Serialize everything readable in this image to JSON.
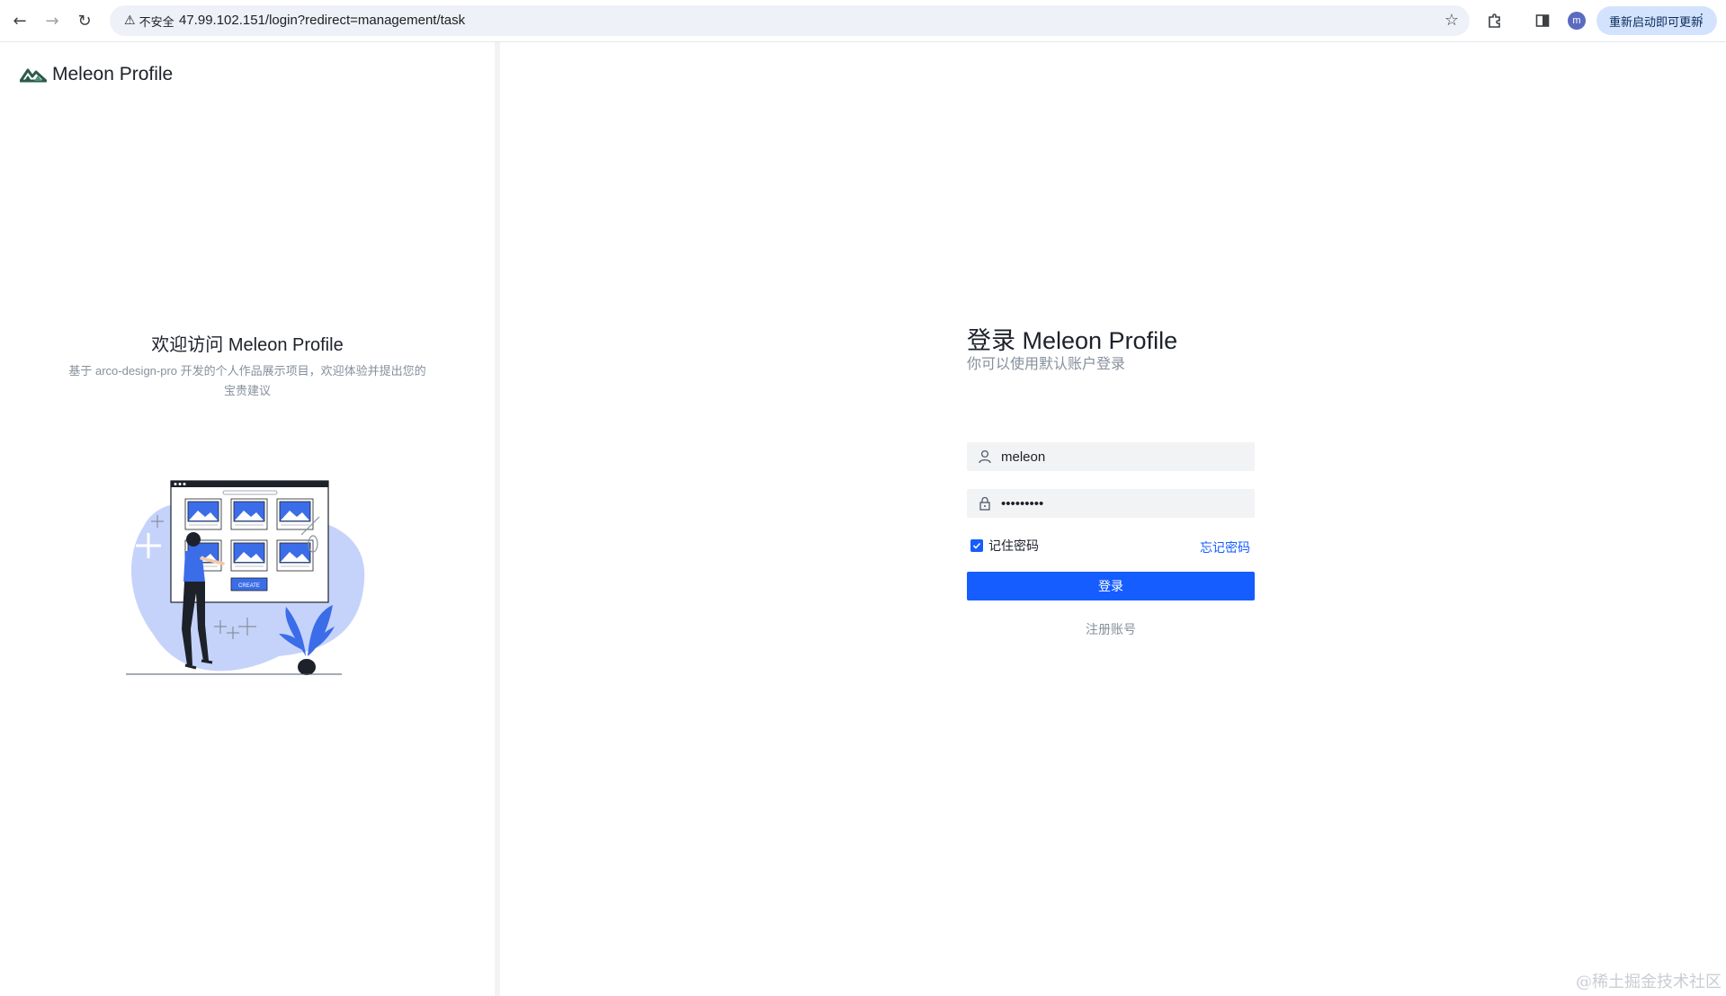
{
  "browser": {
    "back_icon": "←",
    "forward_icon": "→",
    "reload_icon": "↻",
    "security_label": "不安全",
    "url": "47.99.102.151/login?redirect=management/task",
    "profile_initial": "m",
    "update_label": "重新启动即可更新",
    "menu_icon": "⋮"
  },
  "brand": {
    "name": "Meleon Profile"
  },
  "welcome": {
    "title": "欢迎访问 Meleon Profile",
    "subtitle": "基于 arco-design-pro 开发的个人作品展示项目，欢迎体验并提出您的宝贵建议",
    "illustration_button": "CREATE"
  },
  "login": {
    "title": "登录 Meleon Profile",
    "subtitle": "你可以使用默认账户登录",
    "username_value": "meleon",
    "password_value": "•••••••••",
    "remember_label": "记住密码",
    "remember_checked": true,
    "forgot_label": "忘记密码",
    "submit_label": "登录",
    "register_label": "注册账号"
  },
  "watermark": "@稀土掘金技术社区",
  "colors": {
    "primary": "#165dff",
    "input_bg": "#f2f3f5",
    "muted_text": "#86909c",
    "brand_mark": "#2b5a4b"
  }
}
